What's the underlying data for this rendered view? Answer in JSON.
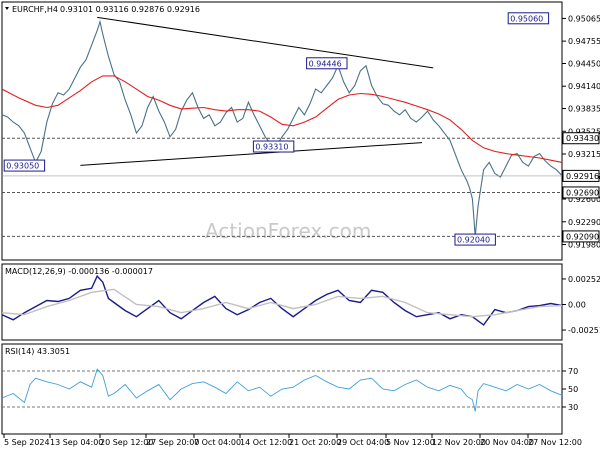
{
  "chart_data": {
    "header": {
      "symbol": "EURCHF,H4",
      "ohlc": "0.93101 0.93116 0.92876 0.92916"
    },
    "watermark": "ActionForex.com",
    "x_axis": {
      "tick_labels": [
        "5 Sep 2024",
        "13 Sep 04:00",
        "20 Sep 12:00",
        "27 Sep 20:00",
        "7 Oct 04:00",
        "14 Oct 12:00",
        "21 Oct 20:00",
        "29 Oct 04:00",
        "5 Nov 12:00",
        "12 Nov 20:00",
        "20 Nov 04:00",
        "27 Nov 12:00"
      ]
    },
    "panels": [
      {
        "name": "price",
        "type": "line",
        "ylim": [
          0.9185,
          0.9518
        ],
        "y_ticks": [
          "0.95065",
          "0.94755",
          "0.94450",
          "0.94140",
          "0.93835",
          "0.93525",
          "0.93215",
          "0.92905",
          "0.92600",
          "0.92290",
          "0.91980"
        ],
        "current_value_label": "0.92916",
        "level_labels": [
          "0.93430",
          "0.92690",
          "0.92090"
        ],
        "levels": [
          0.9343,
          0.9269,
          0.9209
        ],
        "annotations": [
          {
            "text": "0.95060",
            "x": 0.94,
            "y": 0.9506
          },
          {
            "text": "0.94446",
            "x": 0.58,
            "y": 0.94446
          },
          {
            "text": "0.93310",
            "x": 0.485,
            "y": 0.9331
          },
          {
            "text": "0.93050",
            "x": 0.04,
            "y": 0.9305
          },
          {
            "text": "0.92040",
            "x": 0.845,
            "y": 0.9204
          }
        ],
        "trendlines": [
          {
            "from": [
              0.14,
              0.9306
            ],
            "to": [
              0.75,
              0.9337
            ]
          },
          {
            "from": [
              0.17,
              0.9508
            ],
            "to": [
              0.77,
              0.9439
            ]
          }
        ],
        "series": [
          {
            "key": "price",
            "color": "#4a7088",
            "x": [
              0,
              0.01,
              0.02,
              0.03,
              0.04,
              0.05,
              0.06,
              0.07,
              0.08,
              0.09,
              0.1,
              0.11,
              0.12,
              0.13,
              0.14,
              0.15,
              0.16,
              0.17,
              0.175,
              0.18,
              0.19,
              0.2,
              0.21,
              0.22,
              0.23,
              0.24,
              0.25,
              0.26,
              0.27,
              0.28,
              0.29,
              0.3,
              0.31,
              0.32,
              0.33,
              0.34,
              0.35,
              0.36,
              0.37,
              0.38,
              0.39,
              0.4,
              0.41,
              0.42,
              0.43,
              0.44,
              0.45,
              0.46,
              0.47,
              0.48,
              0.49,
              0.5,
              0.51,
              0.52,
              0.53,
              0.54,
              0.55,
              0.56,
              0.57,
              0.58,
              0.59,
              0.6,
              0.61,
              0.62,
              0.63,
              0.64,
              0.65,
              0.66,
              0.67,
              0.68,
              0.69,
              0.7,
              0.71,
              0.72,
              0.73,
              0.74,
              0.75,
              0.76,
              0.77,
              0.78,
              0.79,
              0.8,
              0.81,
              0.82,
              0.83,
              0.835,
              0.84,
              0.843,
              0.845,
              0.85,
              0.86,
              0.87,
              0.88,
              0.89,
              0.9,
              0.91,
              0.92,
              0.93,
              0.94,
              0.95,
              0.96,
              0.97,
              0.98,
              0.99,
              1.0
            ],
            "y": [
              0.9375,
              0.9372,
              0.9365,
              0.936,
              0.935,
              0.933,
              0.931,
              0.9325,
              0.9365,
              0.939,
              0.9405,
              0.9402,
              0.941,
              0.9425,
              0.944,
              0.945,
              0.947,
              0.949,
              0.9502,
              0.9485,
              0.9455,
              0.943,
              0.942,
              0.9395,
              0.9375,
              0.935,
              0.936,
              0.9385,
              0.94,
              0.938,
              0.9365,
              0.9345,
              0.9355,
              0.938,
              0.9395,
              0.9405,
              0.9385,
              0.937,
              0.9375,
              0.936,
              0.9365,
              0.9378,
              0.9385,
              0.9365,
              0.937,
              0.9392,
              0.9375,
              0.936,
              0.9345,
              0.9335,
              0.9332,
              0.9345,
              0.9355,
              0.937,
              0.9385,
              0.9375,
              0.939,
              0.941,
              0.9405,
              0.9415,
              0.9425,
              0.9442,
              0.942,
              0.9405,
              0.9415,
              0.9435,
              0.9442,
              0.9415,
              0.94,
              0.939,
              0.9388,
              0.938,
              0.9375,
              0.9382,
              0.937,
              0.9365,
              0.9372,
              0.938,
              0.9368,
              0.936,
              0.935,
              0.934,
              0.932,
              0.93,
              0.9285,
              0.9275,
              0.926,
              0.923,
              0.9208,
              0.925,
              0.93,
              0.931,
              0.9295,
              0.929,
              0.9305,
              0.932,
              0.9322,
              0.931,
              0.9305,
              0.9318,
              0.9322,
              0.9312,
              0.9305,
              0.93,
              0.9292
            ]
          },
          {
            "key": "moving_average",
            "color": "#e02020",
            "x": [
              0,
              0.03,
              0.06,
              0.08,
              0.1,
              0.12,
              0.14,
              0.16,
              0.18,
              0.2,
              0.22,
              0.24,
              0.26,
              0.28,
              0.3,
              0.32,
              0.34,
              0.36,
              0.38,
              0.4,
              0.42,
              0.44,
              0.46,
              0.48,
              0.5,
              0.52,
              0.54,
              0.56,
              0.58,
              0.6,
              0.62,
              0.64,
              0.66,
              0.68,
              0.7,
              0.72,
              0.74,
              0.76,
              0.78,
              0.8,
              0.82,
              0.84,
              0.86,
              0.88,
              0.9,
              0.92,
              0.94,
              0.96,
              0.98,
              1.0
            ],
            "y": [
              0.941,
              0.9398,
              0.9388,
              0.9385,
              0.9388,
              0.9398,
              0.9408,
              0.942,
              0.9428,
              0.9428,
              0.942,
              0.941,
              0.94,
              0.9395,
              0.9388,
              0.9383,
              0.9384,
              0.9385,
              0.9382,
              0.938,
              0.9382,
              0.9382,
              0.938,
              0.9372,
              0.9362,
              0.936,
              0.9365,
              0.9372,
              0.9384,
              0.9396,
              0.9402,
              0.9404,
              0.9403,
              0.94,
              0.9396,
              0.9392,
              0.9387,
              0.9382,
              0.9376,
              0.9368,
              0.9355,
              0.934,
              0.933,
              0.9325,
              0.9322,
              0.932,
              0.9318,
              0.9316,
              0.9313,
              0.931
            ]
          }
        ]
      },
      {
        "name": "macd",
        "label": "MACD(12,26,9) -0.000136 -0.000017",
        "type": "line",
        "ylim": [
          -0.0029,
          0.0034
        ],
        "y_ticks": [
          "0.00252",
          "0.00",
          "-0.002511"
        ],
        "series": [
          {
            "key": "macd_main",
            "color": "#1a1a8c",
            "x": [
              0,
              0.02,
              0.04,
              0.06,
              0.08,
              0.1,
              0.12,
              0.14,
              0.16,
              0.17,
              0.18,
              0.19,
              0.2,
              0.22,
              0.24,
              0.26,
              0.28,
              0.3,
              0.32,
              0.34,
              0.36,
              0.38,
              0.4,
              0.42,
              0.44,
              0.46,
              0.48,
              0.5,
              0.52,
              0.54,
              0.56,
              0.58,
              0.6,
              0.62,
              0.64,
              0.66,
              0.68,
              0.7,
              0.72,
              0.74,
              0.76,
              0.78,
              0.8,
              0.82,
              0.84,
              0.86,
              0.88,
              0.9,
              0.92,
              0.94,
              0.96,
              0.98,
              1.0
            ],
            "y": [
              -0.001,
              -0.0015,
              -0.0008,
              -0.0002,
              0.0004,
              0.0003,
              0.0006,
              0.0014,
              0.0016,
              0.0028,
              0.0022,
              0.0006,
              0.0002,
              -0.0006,
              -0.0012,
              -0.0004,
              0.0004,
              -0.0008,
              -0.0014,
              -0.0006,
              0.0002,
              0.0008,
              -0.0004,
              -0.001,
              -0.0005,
              0.0002,
              0.0006,
              -0.0004,
              -0.0012,
              -0.0004,
              0.0004,
              0.001,
              0.0014,
              0.0004,
              0.0002,
              0.0014,
              0.0012,
              0.0002,
              -0.0006,
              -0.0012,
              -0.001,
              -0.0008,
              -0.0014,
              -0.001,
              -0.0012,
              -0.002,
              -0.0005,
              -0.0008,
              -0.0006,
              -0.0002,
              -0.0001,
              0.0001,
              -0.0001
            ]
          },
          {
            "key": "macd_signal",
            "color": "#c0c0c0",
            "x": [
              0,
              0.04,
              0.08,
              0.12,
              0.16,
              0.2,
              0.24,
              0.28,
              0.32,
              0.36,
              0.4,
              0.44,
              0.48,
              0.52,
              0.56,
              0.6,
              0.64,
              0.68,
              0.72,
              0.76,
              0.8,
              0.84,
              0.88,
              0.92,
              0.96,
              1.0
            ],
            "y": [
              -0.0008,
              -0.001,
              -0.0002,
              0.0004,
              0.0012,
              0.0015,
              0.0,
              -0.0002,
              -0.0008,
              -0.0004,
              0.0002,
              -0.0004,
              0.0002,
              -0.0004,
              0.0,
              0.0008,
              0.0006,
              0.0008,
              0.0002,
              -0.0008,
              -0.001,
              -0.0012,
              -0.001,
              -0.0006,
              -0.0002,
              -0.0001
            ]
          }
        ]
      },
      {
        "name": "rsi",
        "label": "RSI(14) 43.3051",
        "type": "line",
        "ylim": [
          0,
          100
        ],
        "y_ticks": [
          "70",
          "50",
          "30"
        ],
        "levels": [
          70,
          30
        ],
        "series": [
          {
            "key": "rsi",
            "color": "#3f9fdb",
            "x": [
              0,
              0.02,
              0.04,
              0.05,
              0.06,
              0.08,
              0.1,
              0.12,
              0.14,
              0.16,
              0.17,
              0.18,
              0.19,
              0.2,
              0.22,
              0.24,
              0.26,
              0.28,
              0.3,
              0.32,
              0.34,
              0.36,
              0.38,
              0.4,
              0.42,
              0.44,
              0.46,
              0.48,
              0.5,
              0.52,
              0.54,
              0.56,
              0.58,
              0.6,
              0.62,
              0.64,
              0.66,
              0.68,
              0.7,
              0.72,
              0.74,
              0.76,
              0.78,
              0.8,
              0.82,
              0.83,
              0.84,
              0.845,
              0.85,
              0.86,
              0.88,
              0.9,
              0.92,
              0.94,
              0.96,
              0.98,
              1.0
            ],
            "y": [
              40,
              45,
              35,
              55,
              62,
              58,
              55,
              50,
              58,
              52,
              72,
              65,
              42,
              45,
              55,
              40,
              48,
              55,
              38,
              50,
              56,
              58,
              52,
              45,
              58,
              48,
              52,
              42,
              50,
              52,
              60,
              65,
              58,
              52,
              50,
              60,
              62,
              50,
              48,
              55,
              60,
              52,
              48,
              54,
              50,
              42,
              38,
              25,
              48,
              56,
              52,
              48,
              55,
              50,
              55,
              48,
              43
            ]
          }
        ]
      }
    ]
  }
}
